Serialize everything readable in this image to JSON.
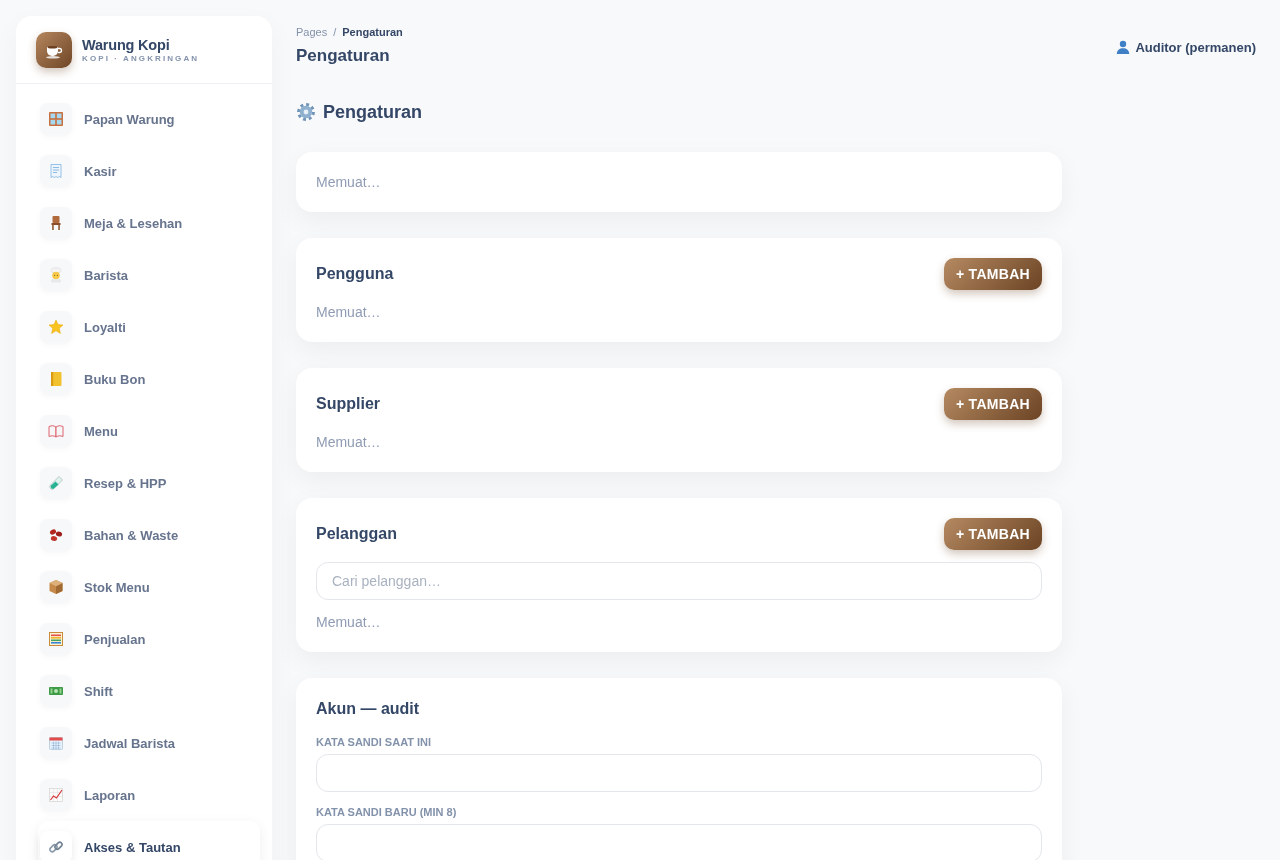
{
  "sidebar": {
    "brand": {
      "title": "Warung Kopi",
      "subtitle": "KOPI · ANGKRINGAN"
    },
    "items": [
      {
        "label": "Papan Warung",
        "selected": false
      },
      {
        "label": "Kasir",
        "selected": false
      },
      {
        "label": "Meja & Lesehan",
        "selected": false
      },
      {
        "label": "Barista",
        "selected": false
      },
      {
        "label": "Loyalti",
        "selected": false
      },
      {
        "label": "Buku Bon",
        "selected": false
      },
      {
        "label": "Menu",
        "selected": false
      },
      {
        "label": "Resep & HPP",
        "selected": false
      },
      {
        "label": "Bahan & Waste",
        "selected": false
      },
      {
        "label": "Stok Menu",
        "selected": false
      },
      {
        "label": "Penjualan",
        "selected": false
      },
      {
        "label": "Shift",
        "selected": false
      },
      {
        "label": "Jadwal Barista",
        "selected": false
      },
      {
        "label": "Laporan",
        "selected": false
      },
      {
        "label": "Akses & Tautan",
        "selected": true
      }
    ]
  },
  "header": {
    "breadcrumb": [
      "Pages",
      "Pengaturan"
    ],
    "separator": "/",
    "title": "Pengaturan",
    "user": "Auditor (permanen)"
  },
  "page_heading": "Pengaturan",
  "cards": [
    {
      "kind": "status",
      "status": "Memuat…"
    },
    {
      "kind": "list",
      "title": "Pengguna",
      "button": "+ TAMBAH",
      "status": "Memuat…"
    },
    {
      "kind": "list",
      "title": "Supplier",
      "button": "+ TAMBAH",
      "status": "Memuat…"
    },
    {
      "kind": "list",
      "title": "Pelanggan",
      "button": "+ TAMBAH",
      "search": {
        "placeholder": "Cari pelanggan…"
      },
      "status": "Memuat…"
    },
    {
      "kind": "form",
      "title": "Akun — audit",
      "fields": [
        {
          "label": "KATA SANDI SAAT INI"
        },
        {
          "label": "KATA SANDI BARU (MIN 8)"
        }
      ]
    }
  ]
}
